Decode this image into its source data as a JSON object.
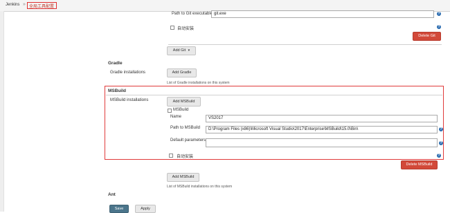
{
  "breadcrumb": {
    "root": "Jenkins",
    "separator": "»",
    "current": "全局工具配置"
  },
  "git": {
    "path_label": "Path to Git executable",
    "path_value": "git.exe",
    "auto_install_label": "自动安装",
    "delete_label": "Delete Git",
    "add_label": "Add Git"
  },
  "gradle": {
    "section_title": "Gradle",
    "installations_label": "Gradle installations",
    "add_label": "Add Gradle",
    "list_hint": "List of Gradle installations on this system"
  },
  "msbuild": {
    "section_title": "MSBuild",
    "installations_label": "MSBuild installations",
    "add_label": "Add MSBuild",
    "item_header": "MSBuild",
    "name_label": "Name",
    "name_value": "VS2017",
    "path_label": "Path to MSBuild",
    "path_value": "D:\\Program Files (x86)\\Microsoft Visual Studio\\2017\\Enterprise\\MSBuild\\15.0\\Bin\\",
    "default_params_label": "Default parameters",
    "default_params_value": "",
    "auto_install_label": "自动安装",
    "delete_label": "Delete MSBuild",
    "add_label_bottom": "Add MSBuild",
    "list_hint": "List of MSBuild installations on this system"
  },
  "ant": {
    "section_title": "Ant"
  },
  "footer": {
    "save_label": "Save",
    "apply_label": "Apply"
  },
  "icons": {
    "help": "help-icon",
    "dropdown": "chevron-down-icon"
  },
  "colors": {
    "delete_red": "#d24939",
    "highlight_red": "#e03030",
    "save_blue": "#4b758b",
    "help_blue": "#2b6cb0"
  }
}
